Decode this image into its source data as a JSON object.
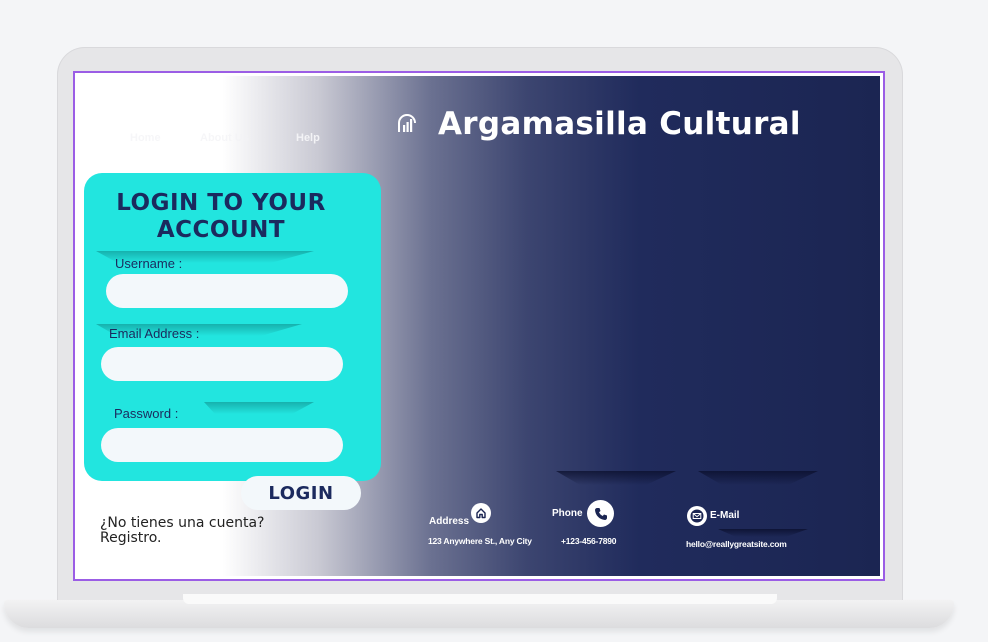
{
  "nav": {
    "home": "Home",
    "about": "About Us",
    "help": "Help"
  },
  "brand": {
    "title": "Argamasilla Cultural",
    "icon": "signal-bars-icon"
  },
  "login_form": {
    "title": "LOGIN TO YOUR ACCOUNT",
    "username_label": "Username  :",
    "email_label": "Email Address  :",
    "password_label": "Password  :",
    "username_value": "",
    "email_value": "",
    "password_value": "",
    "submit_label": "LOGIN"
  },
  "signup": {
    "question": "¿No tienes una cuenta?",
    "link": "Registro."
  },
  "contact": {
    "address_label": "Address",
    "address_value": "123 Anywhere St., Any City",
    "address_icon": "home-icon",
    "phone_label": "Phone",
    "phone_value": "+123-456-7890",
    "phone_icon": "phone-icon",
    "email_label": "E-Mail",
    "email_value": "hello@reallygreatsite.com",
    "email_icon": "envelope-icon"
  },
  "colors": {
    "accent": "#22e5df",
    "navy": "#1b2552",
    "frame": "#9b5de5"
  }
}
